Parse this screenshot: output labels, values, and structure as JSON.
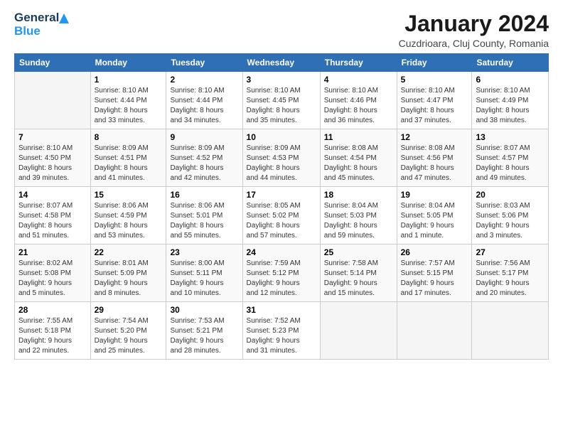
{
  "header": {
    "logo_general": "General",
    "logo_blue": "Blue",
    "title": "January 2024",
    "subtitle": "Cuzdrioara, Cluj County, Romania"
  },
  "days_of_week": [
    "Sunday",
    "Monday",
    "Tuesday",
    "Wednesday",
    "Thursday",
    "Friday",
    "Saturday"
  ],
  "weeks": [
    [
      {
        "day": "",
        "info": ""
      },
      {
        "day": "1",
        "info": "Sunrise: 8:10 AM\nSunset: 4:44 PM\nDaylight: 8 hours\nand 33 minutes."
      },
      {
        "day": "2",
        "info": "Sunrise: 8:10 AM\nSunset: 4:44 PM\nDaylight: 8 hours\nand 34 minutes."
      },
      {
        "day": "3",
        "info": "Sunrise: 8:10 AM\nSunset: 4:45 PM\nDaylight: 8 hours\nand 35 minutes."
      },
      {
        "day": "4",
        "info": "Sunrise: 8:10 AM\nSunset: 4:46 PM\nDaylight: 8 hours\nand 36 minutes."
      },
      {
        "day": "5",
        "info": "Sunrise: 8:10 AM\nSunset: 4:47 PM\nDaylight: 8 hours\nand 37 minutes."
      },
      {
        "day": "6",
        "info": "Sunrise: 8:10 AM\nSunset: 4:49 PM\nDaylight: 8 hours\nand 38 minutes."
      }
    ],
    [
      {
        "day": "7",
        "info": "Sunrise: 8:10 AM\nSunset: 4:50 PM\nDaylight: 8 hours\nand 39 minutes."
      },
      {
        "day": "8",
        "info": "Sunrise: 8:09 AM\nSunset: 4:51 PM\nDaylight: 8 hours\nand 41 minutes."
      },
      {
        "day": "9",
        "info": "Sunrise: 8:09 AM\nSunset: 4:52 PM\nDaylight: 8 hours\nand 42 minutes."
      },
      {
        "day": "10",
        "info": "Sunrise: 8:09 AM\nSunset: 4:53 PM\nDaylight: 8 hours\nand 44 minutes."
      },
      {
        "day": "11",
        "info": "Sunrise: 8:08 AM\nSunset: 4:54 PM\nDaylight: 8 hours\nand 45 minutes."
      },
      {
        "day": "12",
        "info": "Sunrise: 8:08 AM\nSunset: 4:56 PM\nDaylight: 8 hours\nand 47 minutes."
      },
      {
        "day": "13",
        "info": "Sunrise: 8:07 AM\nSunset: 4:57 PM\nDaylight: 8 hours\nand 49 minutes."
      }
    ],
    [
      {
        "day": "14",
        "info": "Sunrise: 8:07 AM\nSunset: 4:58 PM\nDaylight: 8 hours\nand 51 minutes."
      },
      {
        "day": "15",
        "info": "Sunrise: 8:06 AM\nSunset: 4:59 PM\nDaylight: 8 hours\nand 53 minutes."
      },
      {
        "day": "16",
        "info": "Sunrise: 8:06 AM\nSunset: 5:01 PM\nDaylight: 8 hours\nand 55 minutes."
      },
      {
        "day": "17",
        "info": "Sunrise: 8:05 AM\nSunset: 5:02 PM\nDaylight: 8 hours\nand 57 minutes."
      },
      {
        "day": "18",
        "info": "Sunrise: 8:04 AM\nSunset: 5:03 PM\nDaylight: 8 hours\nand 59 minutes."
      },
      {
        "day": "19",
        "info": "Sunrise: 8:04 AM\nSunset: 5:05 PM\nDaylight: 9 hours\nand 1 minute."
      },
      {
        "day": "20",
        "info": "Sunrise: 8:03 AM\nSunset: 5:06 PM\nDaylight: 9 hours\nand 3 minutes."
      }
    ],
    [
      {
        "day": "21",
        "info": "Sunrise: 8:02 AM\nSunset: 5:08 PM\nDaylight: 9 hours\nand 5 minutes."
      },
      {
        "day": "22",
        "info": "Sunrise: 8:01 AM\nSunset: 5:09 PM\nDaylight: 9 hours\nand 8 minutes."
      },
      {
        "day": "23",
        "info": "Sunrise: 8:00 AM\nSunset: 5:11 PM\nDaylight: 9 hours\nand 10 minutes."
      },
      {
        "day": "24",
        "info": "Sunrise: 7:59 AM\nSunset: 5:12 PM\nDaylight: 9 hours\nand 12 minutes."
      },
      {
        "day": "25",
        "info": "Sunrise: 7:58 AM\nSunset: 5:14 PM\nDaylight: 9 hours\nand 15 minutes."
      },
      {
        "day": "26",
        "info": "Sunrise: 7:57 AM\nSunset: 5:15 PM\nDaylight: 9 hours\nand 17 minutes."
      },
      {
        "day": "27",
        "info": "Sunrise: 7:56 AM\nSunset: 5:17 PM\nDaylight: 9 hours\nand 20 minutes."
      }
    ],
    [
      {
        "day": "28",
        "info": "Sunrise: 7:55 AM\nSunset: 5:18 PM\nDaylight: 9 hours\nand 22 minutes."
      },
      {
        "day": "29",
        "info": "Sunrise: 7:54 AM\nSunset: 5:20 PM\nDaylight: 9 hours\nand 25 minutes."
      },
      {
        "day": "30",
        "info": "Sunrise: 7:53 AM\nSunset: 5:21 PM\nDaylight: 9 hours\nand 28 minutes."
      },
      {
        "day": "31",
        "info": "Sunrise: 7:52 AM\nSunset: 5:23 PM\nDaylight: 9 hours\nand 31 minutes."
      },
      {
        "day": "",
        "info": ""
      },
      {
        "day": "",
        "info": ""
      },
      {
        "day": "",
        "info": ""
      }
    ]
  ]
}
